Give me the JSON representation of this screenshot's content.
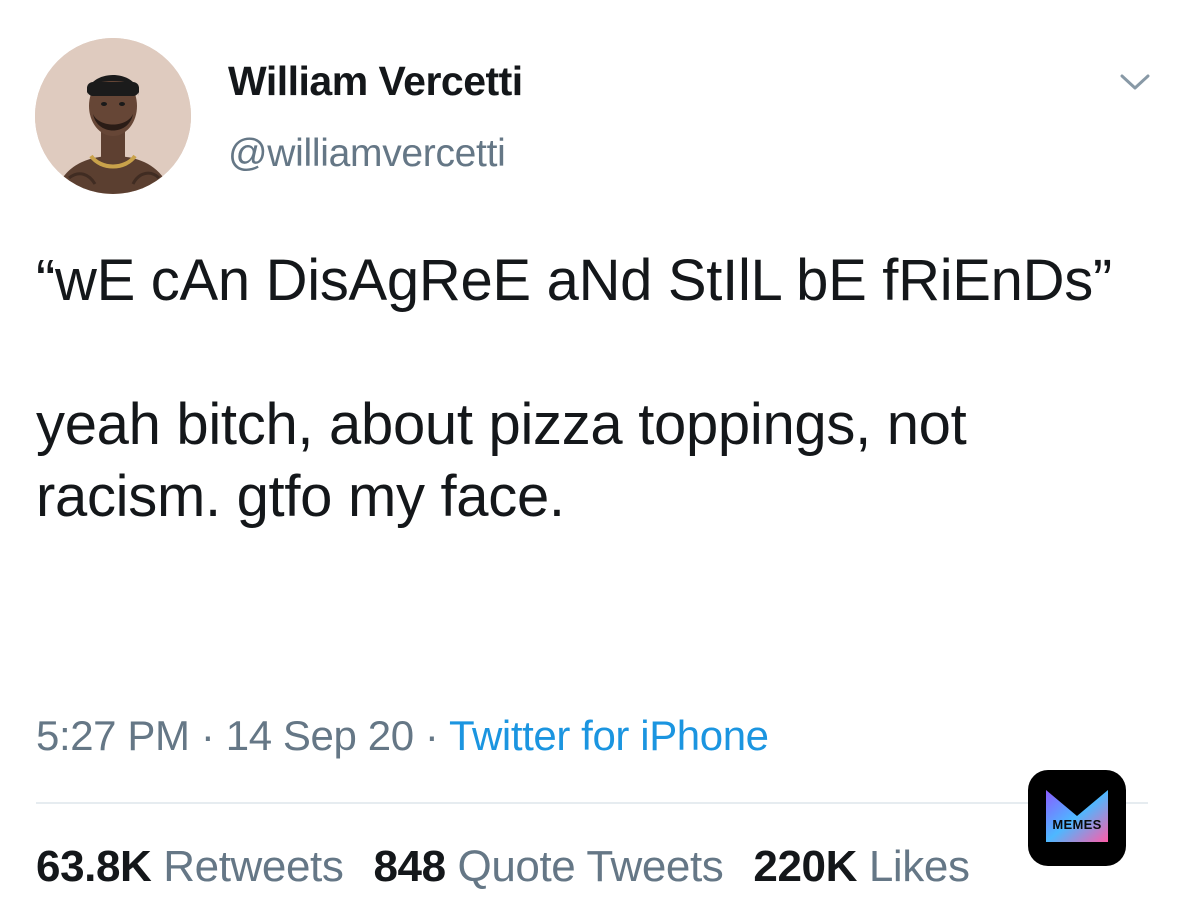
{
  "user": {
    "name": "William Vercetti",
    "handle": "@williamvercetti"
  },
  "tweet": {
    "line1": "“wE cAn DisAgReE aNd StIlL bE fRiEnDs”",
    "line2": "yeah bitch, about pizza toppings, not racism. gtfo my face."
  },
  "meta": {
    "time": "5:27 PM",
    "date": "14 Sep 20",
    "separator": " · ",
    "source": "Twitter for iPhone"
  },
  "stats": {
    "retweets_count": "63.8K",
    "retweets_label": "Retweets",
    "quotes_count": "848",
    "quotes_label": "Quote Tweets",
    "likes_count": "220K",
    "likes_label": "Likes"
  },
  "watermark": {
    "text": "MEMES"
  },
  "icons": {
    "caret": "chevron-down-icon",
    "avatar": "profile-photo"
  },
  "colors": {
    "secondary_text": "#657786",
    "link": "#1b95e0",
    "primary_text": "#14171a",
    "divider": "#e6ecf0"
  }
}
